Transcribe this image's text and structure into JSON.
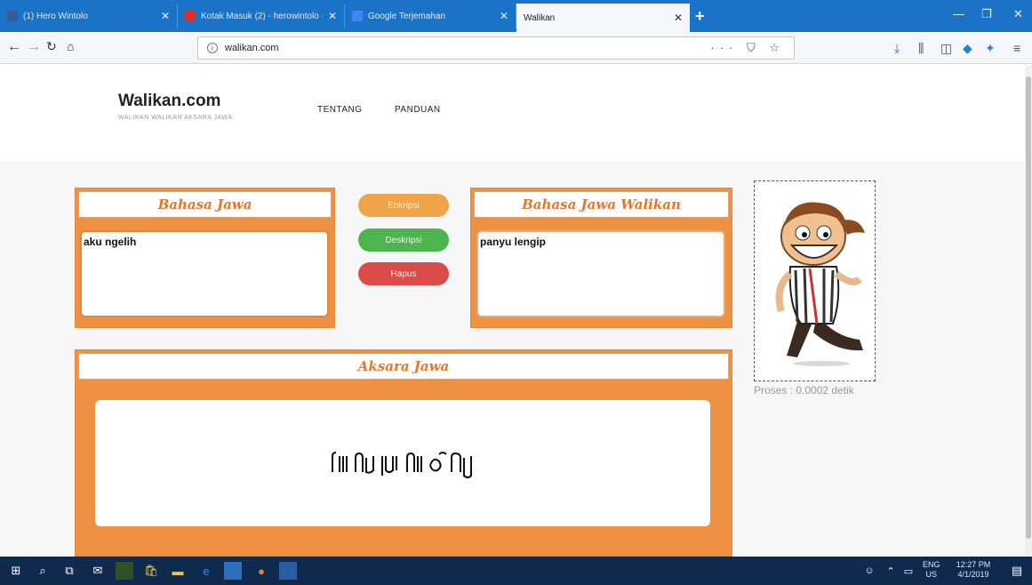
{
  "browser": {
    "tabs": [
      {
        "title": "(1) Hero Wintolo",
        "favicon_color": "#3b5998"
      },
      {
        "title": "Kotak Masuk (2) - herowintolo -",
        "favicon_color": "#d93025"
      },
      {
        "title": "Google Terjemahan",
        "favicon_color": "#4285f4"
      },
      {
        "title": "Walikan",
        "favicon_color": "#f5f6f7"
      }
    ],
    "new_tab": "+",
    "url": "walikan.com",
    "url_actions": "··· ⛉ ☆"
  },
  "site": {
    "brand": "Walikan.com",
    "tagline": "WALIKAN WALIKAN AKSARA JAWA",
    "menu": [
      "TENTANG",
      "PANDUAN"
    ]
  },
  "converter": {
    "source_title": "Bahasa Jawa",
    "source_text": "aku ngelih",
    "result_title": "Bahasa Jawa Walikan",
    "result_text": "panyu lengip",
    "buttons": {
      "encrypt": "Enkripsi",
      "decrypt": "Deskripsi",
      "clear": "Hapus"
    },
    "button_colors": {
      "encrypt": "#f0a448",
      "decrypt": "#4cb550",
      "clear": "#dc4b48"
    },
    "aksara_title": "Aksara Jawa",
    "aksara_text": "ꦥꦚꦸꦭꦺꦁꦒꦶꦥ꧀",
    "proses": "Proses : 0.0002 detik"
  },
  "taskbar": {
    "lang": "ENG",
    "region": "US",
    "time": "12:27 PM",
    "date": "4/1/2019"
  },
  "colors": {
    "accent": "#ef9143",
    "title_orange": "#e8762a",
    "titlebar": "#1a73c7",
    "taskbar": "#102a4e"
  }
}
